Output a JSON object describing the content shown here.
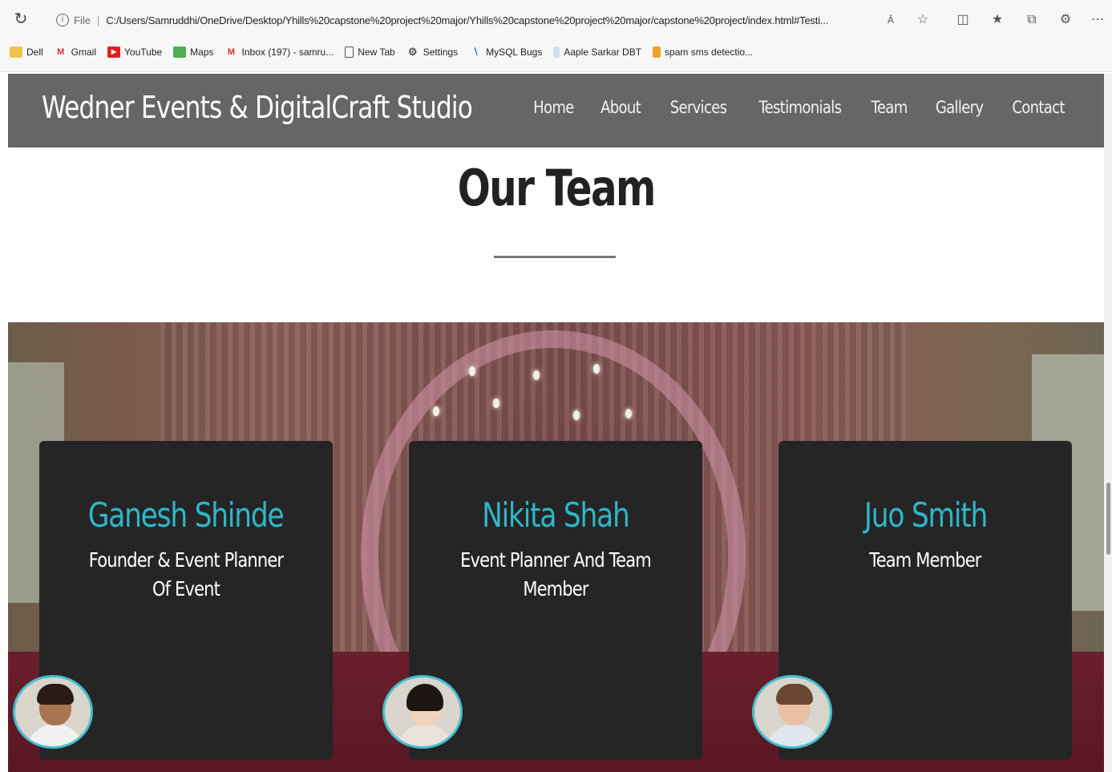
{
  "browser": {
    "file_label": "File",
    "url": "C:/Users/Samruddhi/OneDrive/Desktop/Yhills%20capstone%20project%20major/Yhills%20capstone%20project%20major/capstone%20project/index.html#Testi...",
    "bookmarks": [
      {
        "label": "Dell",
        "icon": "folder-icon"
      },
      {
        "label": "Gmail",
        "icon": "gmail-icon"
      },
      {
        "label": "YouTube",
        "icon": "youtube-icon"
      },
      {
        "label": "Maps",
        "icon": "maps-icon"
      },
      {
        "label": "Inbox (197) - samru...",
        "icon": "gmail-icon"
      },
      {
        "label": "New Tab",
        "icon": "page-icon"
      },
      {
        "label": "Settings",
        "icon": "gear-icon"
      },
      {
        "label": "MySQL Bugs",
        "icon": "mysql-icon"
      },
      {
        "label": "Aaple Sarkar DBT",
        "icon": "site-icon"
      },
      {
        "label": "spam sms detectio...",
        "icon": "site-icon"
      }
    ]
  },
  "site": {
    "brand": "Wedner Events & DigitalCraft Studio",
    "nav": [
      "Home",
      "About",
      "Services",
      "Testimonials",
      "Team",
      "Gallery",
      "Contact"
    ]
  },
  "team": {
    "title": "Our Team",
    "members": [
      {
        "name": "Ganesh Shinde",
        "role": "Founder & Event Planner Of Event"
      },
      {
        "name": "Nikita Shah",
        "role": "Event Planner And Team Member"
      },
      {
        "name": "Juo Smith",
        "role": "Team Member"
      }
    ]
  },
  "colors": {
    "header_bg": "#666666",
    "card_bg": "#252525",
    "accent": "#2fb7c9"
  }
}
